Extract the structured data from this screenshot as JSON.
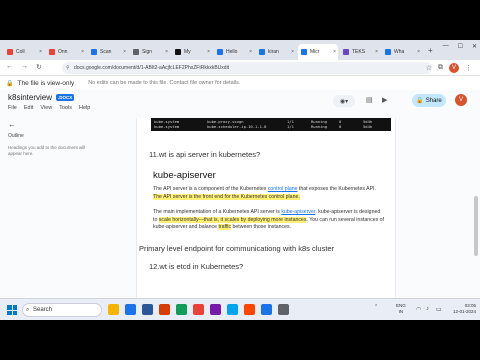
{
  "tabs": [
    {
      "label": "Coll",
      "color": "#ea4335"
    },
    {
      "label": "Onn",
      "color": "#ea4335"
    },
    {
      "label": "Scan",
      "color": "#1a73e8"
    },
    {
      "label": "Sign",
      "color": "#5f6368"
    },
    {
      "label": "My",
      "color": "#111111"
    },
    {
      "label": "Hello",
      "color": "#1a73e8"
    },
    {
      "label": "kiran",
      "color": "#1a73e8"
    },
    {
      "label": "Micr",
      "color": "#1a73e8",
      "active": true
    },
    {
      "label": "TEKS",
      "color": "#6b46c1"
    },
    {
      "label": "Wha",
      "color": "#1a73e8"
    }
  ],
  "address_bar": {
    "url": "docs.google.com/document/d/1-ABIt2-aAcjfcLEF2PhxZFtRkkxkBUxdit"
  },
  "banner": {
    "title": "The file is view-only",
    "subtitle": "No edits can be made to this file. Contact file owner for details."
  },
  "doc": {
    "title": "k8sinterview",
    "badge": ".DOCX",
    "menu": [
      "File",
      "Edit",
      "View",
      "Tools",
      "Help"
    ],
    "share_label": "Share",
    "avatar_letter": "V"
  },
  "outline": {
    "title": "Outline",
    "hint": "Headings you add to the document will appear here."
  },
  "code_rows": [
    [
      "kube-system",
      "kube-proxy-vxxgn",
      "1/1",
      "Running",
      "0",
      "5d4h"
    ],
    [
      "kube-system",
      "kube-scheduler-ip-10-1-1-8",
      "1/1",
      "Running",
      "0",
      "5d4h"
    ]
  ],
  "content": {
    "q11": "11.wt is api server in kubernetes?",
    "heading": "kube-apiserver",
    "p1_a": "The API server is a component of the Kubernetes ",
    "p1_b": "control plane",
    "p1_c": " that exposes the Kubernetes API. ",
    "p1_d": "The API server is the front end for the Kubernetes control plane.",
    "p2_a": "The main implementation of a Kubernetes API server is ",
    "p2_b": "kube-apiserver",
    "p2_c": ". kube-apiserver is designed to ",
    "p2_d": "scale horizontally",
    "p2_e": "—that is, it scales by deploying more instances",
    "p2_f": ". You can run several instances of kube-apiserver and balance ",
    "p2_g": "traffic",
    "p2_h": " between those instances.",
    "primary": "Primary level endpoint for communicationg with k8s cluster",
    "q12": "12.wt is etcd in Kubernetes?"
  },
  "taskbar": {
    "search_placeholder": "Search",
    "lang_top": "ENG",
    "lang_bottom": "IN",
    "time": "03:05",
    "date": "12-01-2024",
    "icons": [
      "#f4b400",
      "#1a73e8",
      "#2b579a",
      "#d83b01",
      "#0f9d58",
      "#ea4335",
      "#7719aa",
      "#00a4ef",
      "#ff4500",
      "#1a73e8",
      "#5f6368"
    ]
  }
}
